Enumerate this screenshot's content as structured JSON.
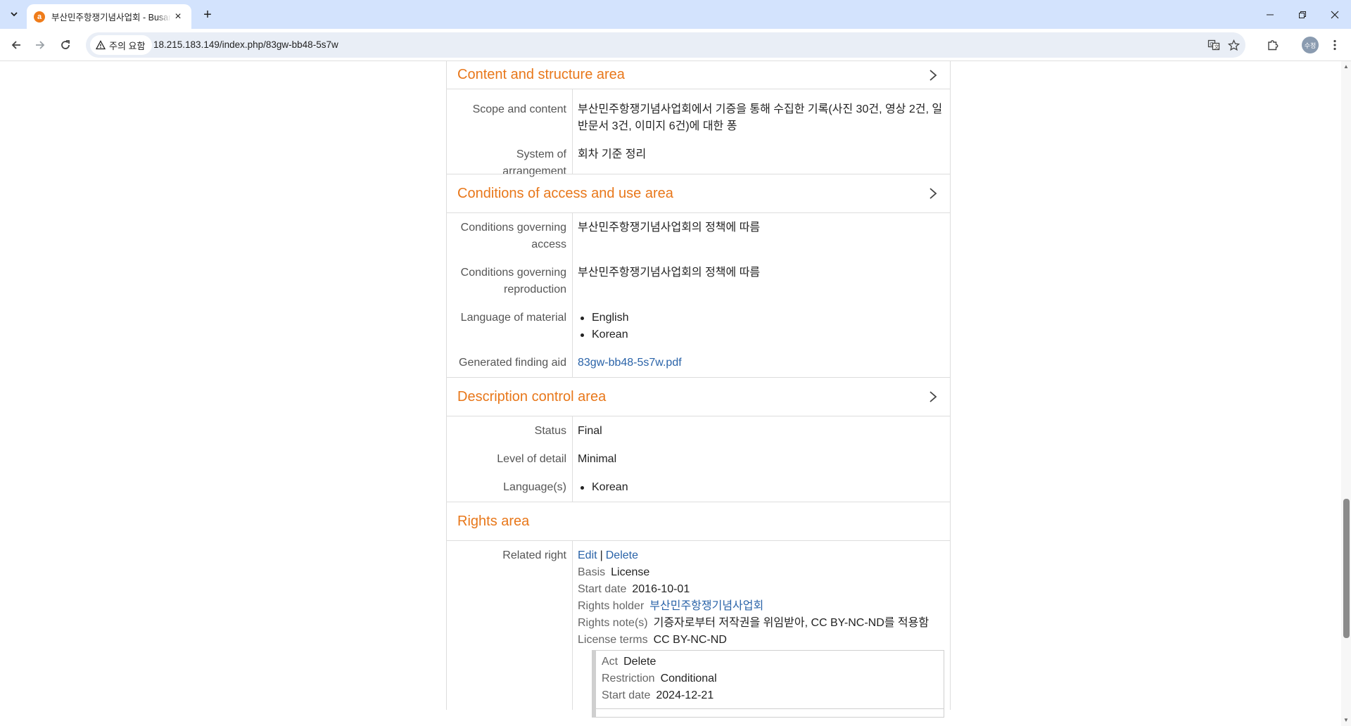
{
  "browser": {
    "tab_title": "부산민주항쟁기념사업회 - Busan",
    "favicon_letter": "a",
    "security_label": "주의 요함",
    "url": "18.215.183.149/index.php/83gw-bb48-5s7w",
    "profile_label": "수정"
  },
  "sections": {
    "content_structure": {
      "title": "Content and structure area",
      "scope_label": "Scope and content",
      "scope_value": "부산민주항쟁기념사업회에서 기증을 통해 수집한 기록(사진 30건, 영상 2건, 일반문서 3건, 이미지 6건)에 대한 퐁",
      "arrangement_label": "System of arrangement",
      "arrangement_value": "회차 기준 정리"
    },
    "access_use": {
      "title": "Conditions of access and use area",
      "access_label": "Conditions governing access",
      "access_value": "부산민주항쟁기념사업회의 정책에 따름",
      "reproduction_label": "Conditions governing reproduction",
      "reproduction_value": "부산민주항쟁기념사업회의 정책에 따름",
      "language_label": "Language of material",
      "languages": [
        "English",
        "Korean"
      ],
      "finding_aid_label": "Generated finding aid",
      "finding_aid_value": "83gw-bb48-5s7w.pdf"
    },
    "description_control": {
      "title": "Description control area",
      "status_label": "Status",
      "status_value": "Final",
      "detail_label": "Level of detail",
      "detail_value": "Minimal",
      "languages_label": "Language(s)",
      "languages": [
        "Korean"
      ]
    },
    "rights": {
      "title": "Rights area",
      "related_right_label": "Related right",
      "edit_label": "Edit",
      "separator": "|",
      "delete_label": "Delete",
      "basis_label": "Basis",
      "basis_value": "License",
      "start_date_label": "Start date",
      "start_date_value": "2016-10-01",
      "holder_label": "Rights holder",
      "holder_value": "부산민주항쟁기념사업회",
      "note_label": "Rights note(s)",
      "note_value": "기증자로부터 저작권을 위임받아, CC BY-NC-ND를 적용함",
      "license_label": "License terms",
      "license_value": "CC BY-NC-ND",
      "granted": {
        "act_label": "Act",
        "act_value": "Delete",
        "restriction_label": "Restriction",
        "restriction_value": "Conditional",
        "start_date_label": "Start date",
        "start_date_value": "2024-12-21"
      }
    }
  }
}
